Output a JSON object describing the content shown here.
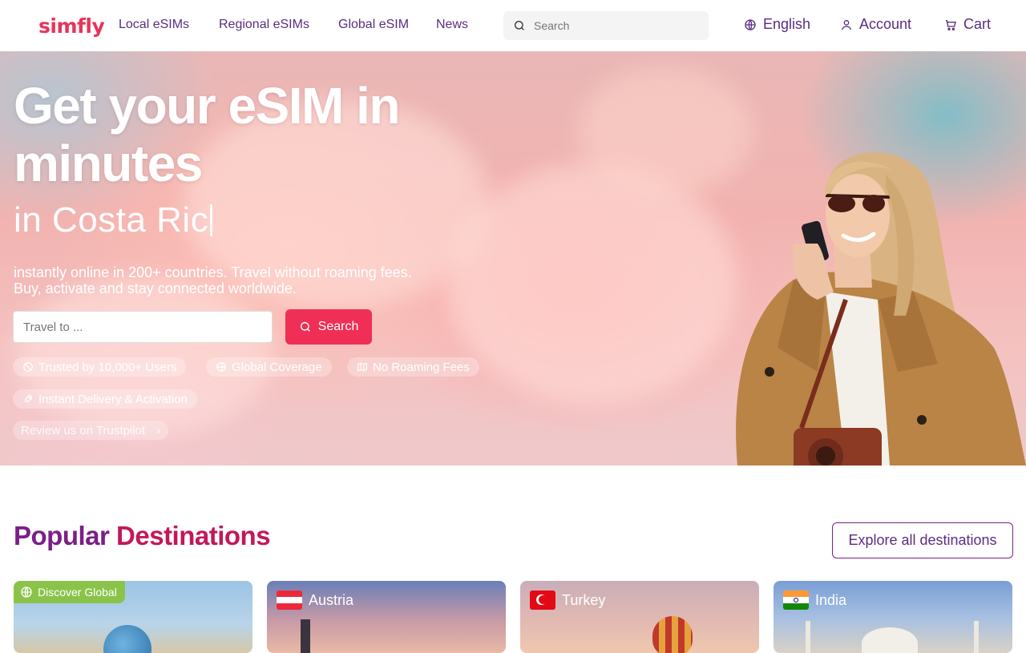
{
  "header": {
    "logo": "simfly",
    "nav": [
      "Local eSIMs",
      "Regional eSIMs",
      "Global eSIM",
      "News"
    ],
    "search_placeholder": "Search",
    "language": "English",
    "account": "Account",
    "cart": "Cart"
  },
  "hero": {
    "title": "Get your eSIM in minutes",
    "subtitle": "in Costa Ric",
    "description_line1": "instantly online in 200+ countries. Travel without roaming fees.",
    "description_line2": "Buy, activate and stay connected worldwide.",
    "travel_placeholder": "Travel to ...",
    "search_button": "Search",
    "badges": [
      {
        "label": "Trusted by 10,000+ Users",
        "icon": "verified-icon"
      },
      {
        "label": "Global Coverage",
        "icon": "globe-icon"
      },
      {
        "label": "No Roaming Fees",
        "icon": "map-icon"
      },
      {
        "label": "Instant Delivery & Activation",
        "icon": "rocket-icon"
      }
    ],
    "trustpilot": "Review us on Trustpilot",
    "trustpilot_arrow": "›"
  },
  "popular": {
    "title_part1": "Popular",
    "title_part2": "Destinations",
    "explore_button": "Explore all destinations",
    "cards": [
      {
        "label": "Discover Global",
        "tag_color": "#8bc34a"
      },
      {
        "label": "Austria"
      },
      {
        "label": "Turkey"
      },
      {
        "label": "India"
      }
    ]
  },
  "colors": {
    "brand": "#e8345a",
    "primary_purple": "#5a2d82",
    "search_button": "#ef2f55",
    "global_tag": "#8bc34a"
  }
}
